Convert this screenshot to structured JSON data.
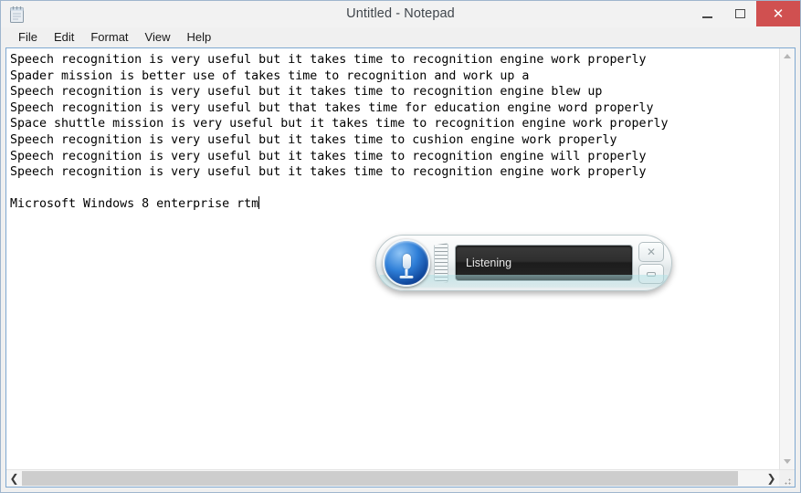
{
  "window": {
    "title": "Untitled - Notepad",
    "app_icon": "notepad-icon",
    "caption": {
      "minimize_label": "Minimize",
      "maximize_label": "Maximize",
      "close_label": "✕",
      "close_color": "#d05050"
    }
  },
  "menu": {
    "items": [
      {
        "label": "File"
      },
      {
        "label": "Edit"
      },
      {
        "label": "Format"
      },
      {
        "label": "View"
      },
      {
        "label": "Help"
      }
    ]
  },
  "document": {
    "lines": [
      "Speech recognition is very useful but it takes time to recognition engine work properly",
      "Spader mission is better use of takes time to recognition and work up a",
      "Speech recognition is very useful but it takes time to recognition engine blew up",
      "Speech recognition is very useful but that takes time for education engine word properly",
      "Space shuttle mission is very useful but it takes time to recognition engine work properly",
      "Speech recognition is very useful but it takes time to cushion engine work properly",
      "Speech recognition is very useful but it takes time to recognition engine will properly",
      "Speech recognition is very useful but it takes time to recognition engine work properly",
      "",
      "Microsoft Windows 8 enterprise rtm"
    ],
    "caret_line_index": 9
  },
  "scrollbars": {
    "vertical": {
      "up_icon": "chevron-up-icon",
      "down_icon": "chevron-down-icon"
    },
    "horizontal": {
      "left_icon": "chevron-left-icon",
      "left_glyph": "❮",
      "right_icon": "chevron-right-icon",
      "right_glyph": "❯",
      "thumb_width_percent": 96.6
    },
    "resize_grip": "resize-grip-icon"
  },
  "speech_widget": {
    "mic_icon": "microphone-icon",
    "level_meter_icon": "audio-level-meter-icon",
    "status_text": "Listening",
    "buttons": {
      "close_glyph": "✕",
      "close_label": "Close",
      "minimize_label": "Minimize"
    }
  }
}
